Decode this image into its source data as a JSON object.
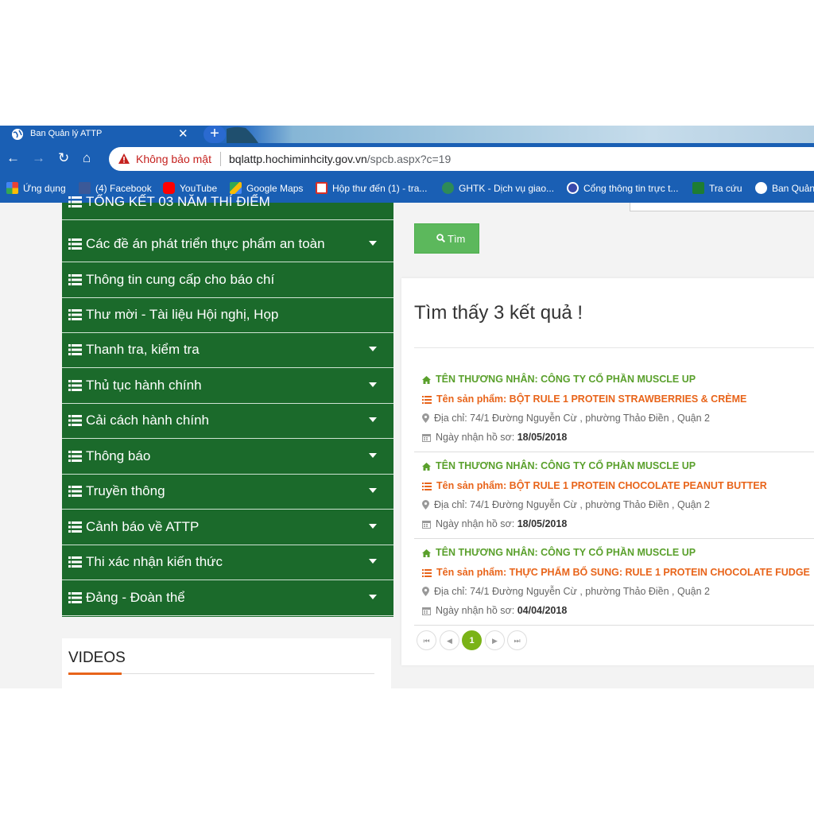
{
  "browser": {
    "tab_title": "Ban Quản lý ATTP",
    "tab_close": "✕",
    "new_tab": "+",
    "security_warning": "Không bảo mật",
    "url_host": "bqlattp.hochiminhcity.gov.vn",
    "url_path": "/spcb.aspx?c=19",
    "bookmarks": [
      {
        "label": "Ứng dụng",
        "icon": "apps-grid-icon",
        "color": "#e94235"
      },
      {
        "label": "(4) Facebook",
        "icon": "facebook-icon",
        "color": "#3b5998"
      },
      {
        "label": "YouTube",
        "icon": "youtube-icon",
        "color": "#ff0000"
      },
      {
        "label": "Google Maps",
        "icon": "google-maps-icon",
        "color": "#34a853"
      },
      {
        "label": "Hộp thư đến (1) - tra...",
        "icon": "gmail-icon",
        "color": "#d93025"
      },
      {
        "label": "GHTK - Dịch vụ giao...",
        "icon": "ghtk-icon",
        "color": "#2e8b57"
      },
      {
        "label": "Cổng thông tin trực t...",
        "icon": "portal-icon",
        "color": "#3949ab"
      },
      {
        "label": "Tra cứu",
        "icon": "lookup-icon",
        "color": "#1e7d32"
      },
      {
        "label": "Ban Quản",
        "icon": "globe-icon",
        "color": "#ffffff"
      }
    ]
  },
  "sidebar": {
    "items": [
      {
        "label": "TỔNG KẾT 03 NĂM THÍ ĐIỂM",
        "has_submenu": false
      },
      {
        "label": "Các đề án phát triển thực phẩm an toàn",
        "has_submenu": true
      },
      {
        "label": "Thông tin cung cấp cho báo chí",
        "has_submenu": false
      },
      {
        "label": "Thư mời - Tài liệu Hội nghị, Họp",
        "has_submenu": false
      },
      {
        "label": "Thanh tra, kiểm tra",
        "has_submenu": true
      },
      {
        "label": "Thủ tục hành chính",
        "has_submenu": true
      },
      {
        "label": "Cải cách hành chính",
        "has_submenu": true
      },
      {
        "label": "Thông báo",
        "has_submenu": true
      },
      {
        "label": "Truyền thông",
        "has_submenu": true
      },
      {
        "label": "Cảnh báo về ATTP",
        "has_submenu": true
      },
      {
        "label": "Thi xác nhận kiến thức",
        "has_submenu": true
      },
      {
        "label": "Đảng - Đoàn thể",
        "has_submenu": true
      }
    ],
    "videos_title": "VIDEOS"
  },
  "search": {
    "button_label": "Tìm"
  },
  "results": {
    "heading": "Tìm thấy 3 kết quả !",
    "items": [
      {
        "merchant": "TÊN THƯƠNG NHÂN: CÔNG TY CỔ PHẦN MUSCLE UP",
        "product": "Tên sản phẩm: BỘT RULE 1 PROTEIN STRAWBERRIES & CRÈME",
        "address": "Địa chỉ: 74/1 Đường Nguyễn Cừ , phường Thảo Điền , Quận 2",
        "date_label": "Ngày nhận hồ sơ:",
        "date": "18/05/2018"
      },
      {
        "merchant": "TÊN THƯƠNG NHÂN: CÔNG TY CỔ PHẦN MUSCLE UP",
        "product": "Tên sản phẩm: BỘT RULE 1 PROTEIN CHOCOLATE PEANUT BUTTER",
        "address": "Địa chỉ: 74/1 Đường Nguyễn Cừ , phường Thảo Điền , Quận 2",
        "date_label": "Ngày nhận hồ sơ:",
        "date": "18/05/2018"
      },
      {
        "merchant": "TÊN THƯƠNG NHÂN: CÔNG TY CỔ PHẦN MUSCLE UP",
        "product": "Tên sản phẩm: THỰC PHẨM BỔ SUNG: RULE 1 PROTEIN CHOCOLATE FUDGE",
        "address": "Địa chỉ: 74/1 Đường Nguyễn Cừ , phường Thảo Điền , Quận 2",
        "date_label": "Ngày nhận hồ sơ:",
        "date": "04/04/2018"
      }
    ],
    "pager": {
      "first": "⏮",
      "prev": "◀",
      "current": "1",
      "next": "▶",
      "last": "⏭"
    }
  },
  "colors": {
    "browser_chrome": "#1a5fb4",
    "menu_bg": "#1b6a2b",
    "merchant": "#5aa02c",
    "product": "#e8641a",
    "search_button": "#5cb85c",
    "pager_active": "#7ab317"
  }
}
